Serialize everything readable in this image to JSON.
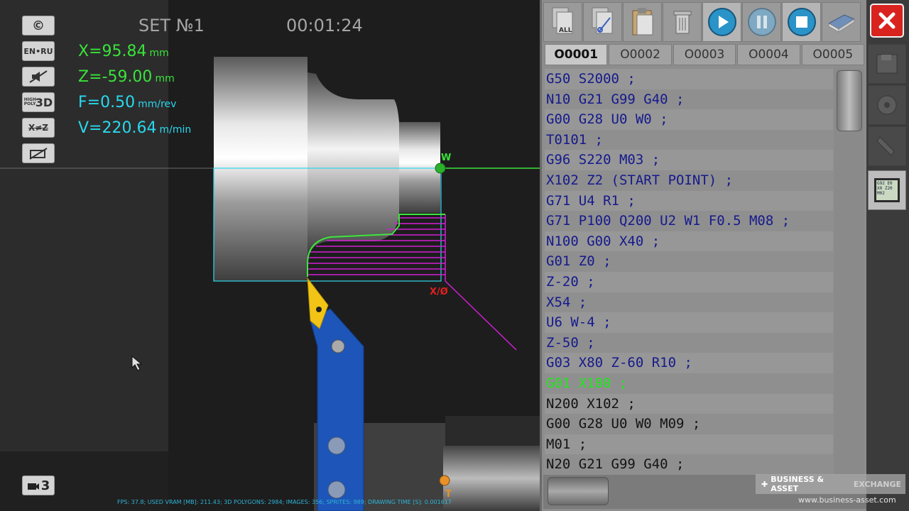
{
  "hud": {
    "set_label": "SET №1",
    "timer": "00:01:24",
    "x_value": "X=95.84",
    "x_unit": "mm",
    "z_value": "Z=-59.00",
    "z_unit": "mm",
    "f_value": "F=0.50",
    "f_unit": "mm/rev",
    "v_value": "V=220.64",
    "v_unit": "m/min",
    "fps_text": "FPS: 37.8; USED VRAM [MB]: 211.43; 3D POLYGONS: 2984; IMAGES: 356; SPRITES: 989; DRAWING TIME [S]: 0.001617",
    "camera_number": "3"
  },
  "left_buttons": {
    "copyright": "©",
    "language": "EN•RU",
    "quality_small": "HIGH POLY",
    "quality_big": "3D",
    "axes": "X≠Z"
  },
  "scene_labels": {
    "workpiece_zero": "W",
    "program_zero": "X/Ø",
    "tool_point": "T"
  },
  "toolbar": {
    "all_label": "ALL",
    "icons": [
      "copy-all-icon",
      "cut-icon",
      "paste-icon",
      "trash-icon",
      "play-icon",
      "pause-icon",
      "stop-icon",
      "book-icon"
    ]
  },
  "tabs": [
    {
      "label": "O0001",
      "active": true
    },
    {
      "label": "O0002",
      "active": false
    },
    {
      "label": "O0003",
      "active": false
    },
    {
      "label": "O0004",
      "active": false
    },
    {
      "label": "O0005",
      "active": false
    }
  ],
  "program_lines": [
    "G50 S2000 ;",
    "N10 G21 G99 G40 ;",
    "G00 G28 U0 W0 ;",
    "T0101 ;",
    "G96 S220 M03 ;",
    "X102 Z2 (START POINT) ;",
    "G71 U4 R1 ;",
    "G71 P100 Q200 U2 W1 F0.5 M08 ;",
    "N100 G00 X40 ;",
    "G01 Z0 ;",
    "Z-20 ;",
    "X54 ;",
    "U6 W-4 ;",
    "Z-50 ;",
    "G03 X80 Z-60 R10 ;",
    "G01 X100 ;",
    "N200 X102 ;",
    "G00 G28 U0 W0 M09 ;",
    "M01 ;",
    "N20 G21 G99 G40 ;"
  ],
  "active_line_index": 15,
  "side": {
    "close_icon": "close-icon",
    "sim_screen_text": "G92 E0\nX0 Z20\nM02"
  },
  "watermark": {
    "label": "BUSINESS & ASSET",
    "tail": "EXCHANGE",
    "url": "www.business-asset.com"
  },
  "colors": {
    "coord_green": "#39e33a",
    "coord_cyan": "#29d8ee",
    "code_blue": "#161a8c",
    "active_line": "#1ee81b",
    "toolpath_magenta": "#d21fd6",
    "contour_green": "#3de63b",
    "tool_blue": "#1d55b8",
    "insert_yellow": "#f2c416",
    "close_red": "#d9231f"
  }
}
